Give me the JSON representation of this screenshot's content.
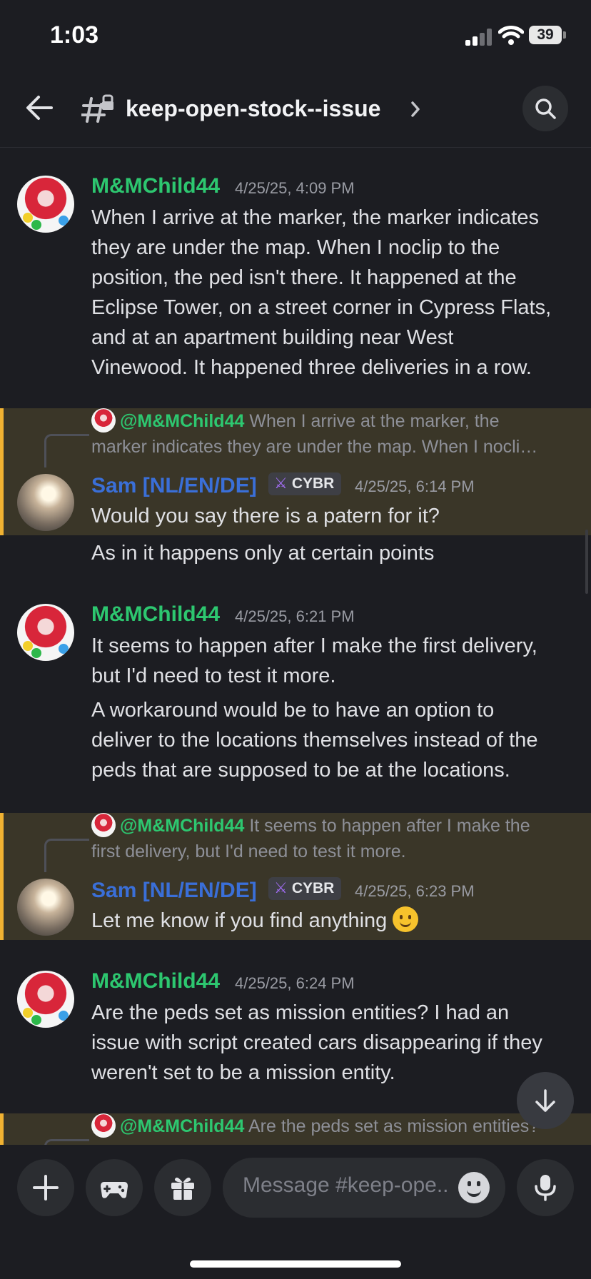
{
  "status": {
    "time": "1:03",
    "battery": "39"
  },
  "header": {
    "channel": "keep-open-stock--issue"
  },
  "messages": [
    {
      "author": "M&MChild44",
      "timestamp": "4/25/25, 4:09 PM",
      "lines": [
        "When I arrive at the marker, the marker indicates",
        "they are under the map. When I noclip to the",
        "position, the ped isn't there. It happened at the",
        "Eclipse Tower, on a street corner in Cypress Flats,",
        "and at an apartment building near West",
        "Vinewood. It happened three deliveries in a row."
      ]
    },
    {
      "reply_to": "@M&MChild44",
      "reply_preview_1": "When I arrive at the marker, the",
      "reply_preview_2": "marker indicates they are under the map. When I nocli…",
      "author": "Sam [NL/EN/DE]",
      "badge": "CYBR",
      "timestamp": "4/25/25, 6:14 PM",
      "text": "Would you say there is a patern for it?",
      "followup": "As in it happens only at certain points"
    },
    {
      "author": "M&MChild44",
      "timestamp": "4/25/25, 6:21 PM",
      "lines": [
        "It seems to happen after I make the first delivery,",
        "but I'd need to test it more."
      ],
      "followup_lines": [
        "A workaround would be to have an option to",
        "deliver to the locations themselves instead of the",
        "peds that are supposed to be at the locations."
      ]
    },
    {
      "reply_to": "@M&MChild44",
      "reply_preview_1": "It seems to happen after I make the",
      "reply_preview_2": "first delivery, but I'd need to test it more.",
      "author": "Sam [NL/EN/DE]",
      "badge": "CYBR",
      "timestamp": "4/25/25, 6:23 PM",
      "text": "Let me know if you find anything"
    },
    {
      "author": "M&MChild44",
      "timestamp": "4/25/25, 6:24 PM",
      "lines": [
        "Are the peds set as mission entities? I had an",
        "issue with script created cars disappearing if they",
        "weren't set to be a mission entity."
      ]
    },
    {
      "reply_to": "@M&MChild44",
      "reply_preview_1": "Are the peds set as mission entities?"
    }
  ],
  "composer": {
    "placeholder": "Message #keep-ope.."
  },
  "colors": {
    "background": "#1c1d22",
    "author_green": "#2dc770",
    "author_blue": "#3a6fd8",
    "reply_highlight": "#3a3628",
    "reply_bar": "#f0b232"
  },
  "icons": [
    "back-arrow-icon",
    "channel-thread-icon",
    "chevron-right-icon",
    "search-icon",
    "plus-icon",
    "gamepad-icon",
    "gift-icon",
    "emoji-icon",
    "microphone-icon",
    "arrow-down-icon"
  ]
}
